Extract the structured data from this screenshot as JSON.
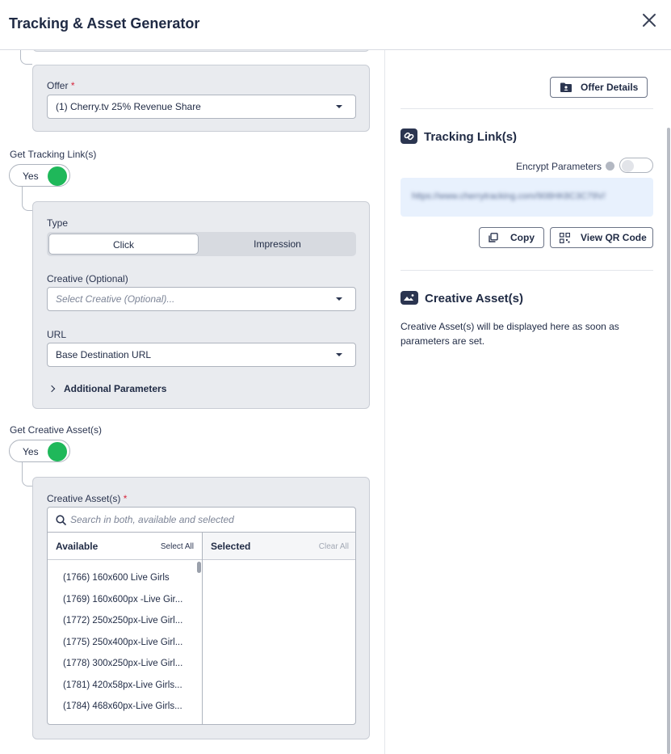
{
  "header": {
    "title": "Tracking & Asset Generator"
  },
  "offer": {
    "label": "Offer",
    "required_mark": "*",
    "value": "(1) Cherry.tv 25% Revenue Share"
  },
  "tracking": {
    "label": "Get Tracking Link(s)",
    "toggle_text": "Yes",
    "toggle_on": true,
    "type_label": "Type",
    "type_options": [
      "Click",
      "Impression"
    ],
    "type_selected": "Click",
    "creative_label": "Creative (Optional)",
    "creative_placeholder": "Select Creative (Optional)...",
    "url_label": "URL",
    "url_value": "Base Destination URL",
    "additional_params": "Additional Parameters"
  },
  "creative": {
    "label": "Get Creative Asset(s)",
    "toggle_text": "Yes",
    "toggle_on": true,
    "field_label": "Creative Asset(s)",
    "required_mark": "*",
    "search_placeholder": "Search in both, available and selected",
    "available_header": "Available",
    "select_all": "Select All",
    "selected_header": "Selected",
    "clear_all": "Clear All",
    "available_items": [
      "(1766) 160x600 Live Girls",
      "(1769) 160x600px -Live Gir...",
      "(1772) 250x250px-Live Girl...",
      "(1775) 250x400px-Live Girl...",
      "(1778) 300x250px-Live Girl...",
      "(1781) 420x58px-Live Girls...",
      "(1784) 468x60px-Live Girls..."
    ],
    "selected_items": []
  },
  "right": {
    "offer_details_button": "Offer Details",
    "tracking_title": "Tracking Link(s)",
    "encrypt_label": "Encrypt Parameters",
    "encrypt_on": false,
    "tracking_url": "https://www.cherrytracking.com/908HK8C3C79V/",
    "copy_button": "Copy",
    "qr_button": "View QR Code",
    "assets_title": "Creative Asset(s)",
    "assets_message": "Creative Asset(s) will be displayed here as soon as parameters are set."
  },
  "colors": {
    "toggle_on": "#1fb85a",
    "panel_bg": "#e9ebef",
    "accent_text": "#1f2a44",
    "link_box": "#e8f1fd"
  },
  "icons": [
    "close-icon",
    "search-icon",
    "chevron-right-icon",
    "folder-user-icon",
    "link-icon",
    "info-icon",
    "copy-icon",
    "qr-code-icon",
    "image-folder-icon"
  ]
}
